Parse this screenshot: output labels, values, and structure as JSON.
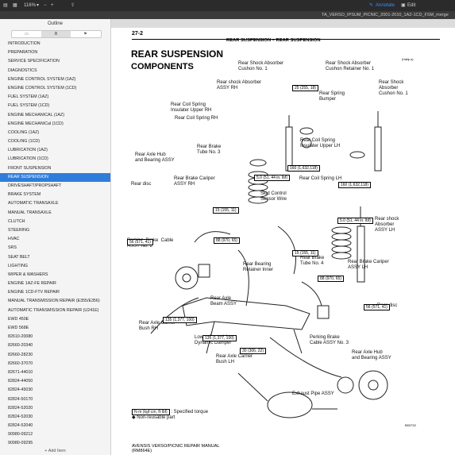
{
  "toolbar": {
    "zoom": "116%",
    "annotate": "Annotate",
    "edit": "Edit"
  },
  "tab": {
    "title": "TA_VERSO_IPSUM_PICNIC_2001-2010_1AZ-1CD_FSM_merge"
  },
  "sidebar": {
    "title": "Outline",
    "add_item": "+ Add Item",
    "items": [
      "INTRODUCTION",
      "PREPARATION",
      "SERVICE SPECIFICATION",
      "DIAGNOSTICS",
      "ENGINE CONTROL SYSTEM (1AZ)",
      "ENGINE CONTROL SYSTEM (1CD)",
      "FUEL SYSTEM (1AZ)",
      "FUEL SYSTEM (1CD)",
      "ENGINE MECHANICAL (1AZ)",
      "ENGINE MECHANICal (1CD)",
      "COOLING (1AZ)",
      "COOLING (1CD)",
      "LUBRICATION (1AZ)",
      "LUBRICATION (1CD)",
      "FRONT SUSPENSION",
      "REAR SUSPENSION",
      "DRIVESHAFT/PROPSHAFT",
      "BRAKE SYSTEM",
      "AUTOMATIC TRANSAXLE",
      "MANUAL TRANSAXLE",
      "CLUTCH",
      "STEERING",
      "HVAC",
      "SRS",
      "SEAT BELT",
      "LIGHTING",
      "WIPER & WASHERS",
      "ENGINE 1AZ-FE REPAIR",
      "ENGINE 1CD-FTV REPAIR",
      "MANUAL TRANSMISSION REPAIR (E355/E356)",
      "AUTOMATIC TRANSMISSION REPAIR (U241E)",
      "EWD 450E",
      "EWD 568E",
      "82610-20080",
      "82660-20340",
      "82660-28230",
      "82660-37070",
      "82671-44010",
      "82824-44050",
      "82824-45030",
      "82824-50170",
      "82824-52020",
      "82824-52030",
      "82824-52040",
      "90980-09212",
      "90980-09295"
    ],
    "selected_index": 15
  },
  "page": {
    "number": "27-2",
    "header_title": "REAR SUSPENSION",
    "header_dash": "–",
    "header_sub": "REAR SUSPENSION",
    "title": "REAR SUSPENSION",
    "subtitle": "COMPONENTS",
    "small_note": "(Hdelp a)",
    "footer_line1": "AVENSIS VERSO/PICNIC REPAIR MANUAL",
    "footer_line2": "(RM864E)",
    "figure_code": "B53732"
  },
  "diagram": {
    "labels": [
      "Rear Shock Absorber\nCushon No. 1",
      "Rear Shock Absorber\nCushon Retainer No. 1",
      "Rear shock Absorber\nASSY RH",
      "Rear Spring\nBumper",
      "Rear Shock\nAbsorber\nCushon No. 1",
      "Rear Coil Spring\nInsulater Upper RH",
      "Rear Coil Spring RH",
      "Rear Coil Spring\nInsulater Upper LH",
      "Rear Brake\nTube No. 3",
      "Rear Axle Hub\nand Bearing ASSY",
      "Rear Brake Cariper\nASSY RH",
      "Rear Coil Spring LH",
      "Rear disc",
      "Skid Control\nSensor Wire",
      "Rear shock\nAbsorber\nASSY LH",
      "Perking  Brake  Cable\nASSY No. 2",
      "Rear Brake\nTube No. 4",
      "Rear Brake Cariper\nASSY LH",
      "Rear Bearing\nRetainer Inner",
      "Rear Axle\nBeam ASSY",
      "Rear disc",
      "Rear Axle Carrier\nBush RH",
      "Lower Control Arm\nDynamic Damper",
      "Perking Brake\nCable ASSY No. 3",
      "Rear Axle Hub\nand Bearing ASSY",
      "Rear Axle Carrier\nBush LH",
      "Exhaust Pipe ASSY"
    ],
    "torques": [
      "25 (255, 18)",
      "160 (1,632,118)",
      "5.0 (51, 44 in. lbf)",
      "160 (1,632,118)",
      "15 (155, 11)",
      "5.0 (51, 44 in. lbf)",
      "88 (970, 65)",
      "56 (571, 41)",
      "15 (155, 11)",
      "88 (970, 65)",
      "56 (571, 41)",
      "135 (1,377, 100)",
      "135 (1,377, 100)",
      "30 (306, 22)"
    ],
    "legend_torque": "N·m (kgf·cm, ft·lbf)",
    "legend_torque_desc": ": Specified torque",
    "legend_nonreusable": "Non-reusable part"
  }
}
